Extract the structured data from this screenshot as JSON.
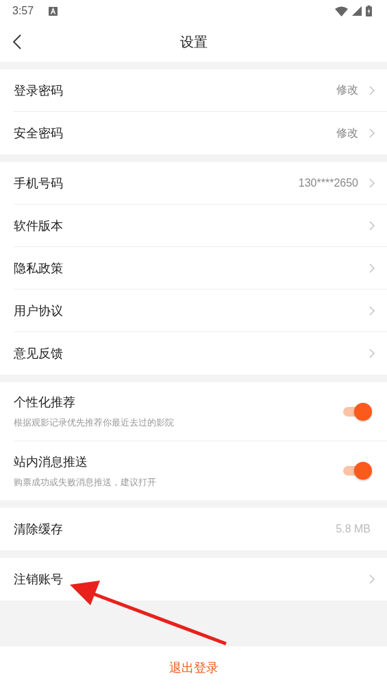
{
  "status_bar": {
    "time": "3:57"
  },
  "header": {
    "title": "设置"
  },
  "sections": [
    {
      "rows": [
        {
          "kind": "link",
          "label": "登录密码",
          "value": "修改"
        },
        {
          "kind": "link",
          "label": "安全密码",
          "value": "修改"
        }
      ]
    },
    {
      "rows": [
        {
          "kind": "link",
          "label": "手机号码",
          "value": "130****2650"
        },
        {
          "kind": "link",
          "label": "软件版本"
        },
        {
          "kind": "link",
          "label": "隐私政策"
        },
        {
          "kind": "link",
          "label": "用户协议"
        },
        {
          "kind": "link",
          "label": "意见反馈"
        }
      ]
    },
    {
      "rows": [
        {
          "kind": "toggle",
          "label": "个性化推荐",
          "description": "根据观影记录优先推荐你最近去过的影院",
          "on": true
        },
        {
          "kind": "toggle",
          "label": "站内消息推送",
          "description": "购票成功或失败消息推送，建议打开",
          "on": true
        }
      ]
    },
    {
      "rows": [
        {
          "kind": "value",
          "label": "清除缓存",
          "value": "5.8 MB"
        }
      ]
    },
    {
      "rows": [
        {
          "kind": "link",
          "label": "注销账号"
        }
      ]
    }
  ],
  "logout_button": "退出登录"
}
